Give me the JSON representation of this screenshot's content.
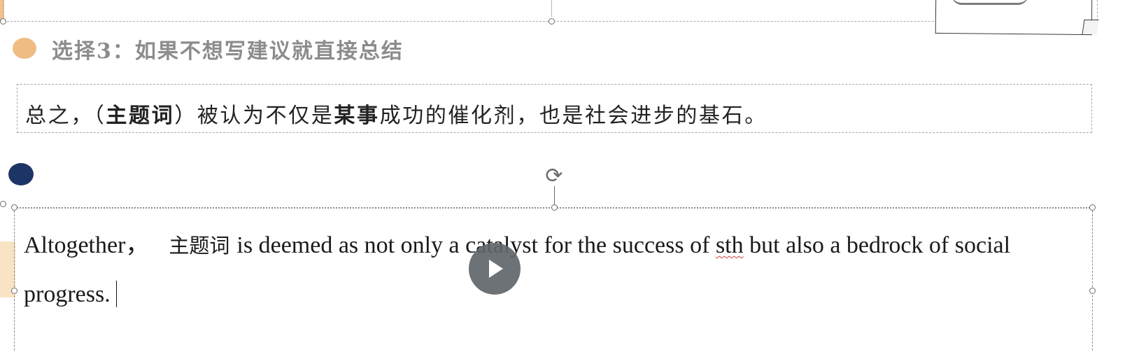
{
  "heading": {
    "text": "选择3：如果不想写建议就直接总结"
  },
  "cn_template": {
    "part1": "总之，（",
    "keyword": "主题词",
    "part2": "）被认为不仅是",
    "sth": "某事",
    "part3": "成功的催化剂，也是社会进步的基石。"
  },
  "en_text": {
    "part1": "Altogether，",
    "cn_word": "主题词",
    "part2": "is deemed as not only a catalyst for the success of ",
    "spell_word": "sth",
    "part3": " but also a bedrock of social progress."
  },
  "colors": {
    "bullet_orange": "#efbd84",
    "bullet_navy": "#1d3566",
    "heading_gray": "#8c8c8c",
    "play_overlay": "#60666a"
  },
  "icons": {
    "rotate": "rotate-handle-icon",
    "play": "play-icon"
  }
}
